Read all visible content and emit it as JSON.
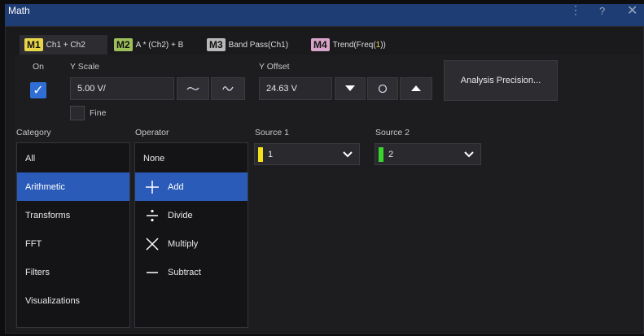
{
  "window": {
    "title": "Math"
  },
  "tabs": [
    {
      "badge": "M1",
      "label": "Ch1 + Ch2",
      "badge_color": "#e8d64a"
    },
    {
      "badge": "M2",
      "label": "A * (Ch2) + B",
      "badge_color": "#9dbf5a"
    },
    {
      "badge": "M3",
      "label": "Band Pass(Ch1)",
      "badge_color": "#b9b9b9"
    },
    {
      "badge": "M4",
      "label_pre": "Trend(Freq(",
      "label_num": "1",
      "label_post": "))",
      "badge_color": "#d7a3c8"
    }
  ],
  "controls": {
    "on_label": "On",
    "on_checked": true,
    "yscale_label": "Y Scale",
    "yscale_value": "5.00 V/",
    "fine_label": "Fine",
    "fine_checked": false,
    "yoffset_label": "Y Offset",
    "yoffset_value": "24.63 V",
    "analysis_button": "Analysis Precision..."
  },
  "category": {
    "header": "Category",
    "items": [
      "All",
      "Arithmetic",
      "Transforms",
      "FFT",
      "Filters",
      "Visualizations"
    ],
    "selected": "Arithmetic"
  },
  "operator": {
    "header": "Operator",
    "items": [
      {
        "label": "None",
        "icon": ""
      },
      {
        "label": "Add",
        "icon": "plus-icon"
      },
      {
        "label": "Divide",
        "icon": "divide-icon"
      },
      {
        "label": "Multiply",
        "icon": "multiply-icon"
      },
      {
        "label": "Subtract",
        "icon": "minus-icon"
      }
    ],
    "selected": "Add"
  },
  "source1": {
    "label": "Source 1",
    "value": "1",
    "color": "#f1e21d"
  },
  "source2": {
    "label": "Source 2",
    "value": "2",
    "color": "#39d52f"
  }
}
